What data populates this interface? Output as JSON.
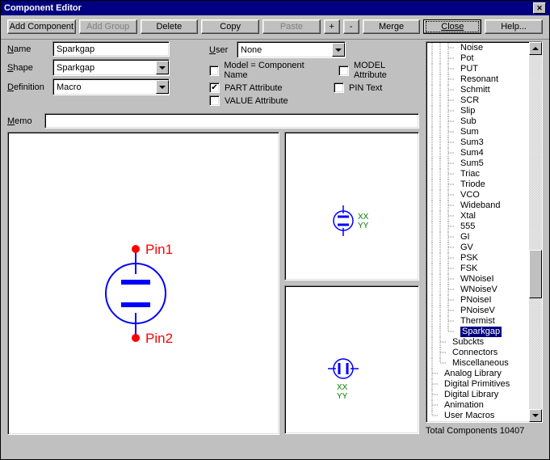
{
  "title": "Component Editor",
  "toolbar": {
    "add_component": "Add Component",
    "add_group": "Add Group",
    "delete": "Delete",
    "copy": "Copy",
    "paste": "Paste",
    "plus": "+",
    "minus": "-",
    "merge": "Merge",
    "close": "Close",
    "help": "Help..."
  },
  "form": {
    "name_label": "Name",
    "name_value": "Sparkgap",
    "shape_label": "Shape",
    "shape_value": "Sparkgap",
    "definition_label": "Definition",
    "definition_value": "Macro",
    "user_label": "User",
    "user_value": "None",
    "chk_model_comp": "Model = Component Name",
    "chk_part_attr": "PART Attribute",
    "chk_value_attr": "VALUE Attribute",
    "chk_model_attr": "MODEL Attribute",
    "chk_pin_text": "PIN Text",
    "memo_label": "Memo"
  },
  "preview": {
    "pin1": "Pin1",
    "pin2": "Pin2",
    "xx": "XX",
    "yy": "YY"
  },
  "tree": {
    "items": [
      {
        "level": 3,
        "label": "Noise"
      },
      {
        "level": 3,
        "label": "Pot"
      },
      {
        "level": 3,
        "label": "PUT"
      },
      {
        "level": 3,
        "label": "Resonant"
      },
      {
        "level": 3,
        "label": "Schmitt"
      },
      {
        "level": 3,
        "label": "SCR"
      },
      {
        "level": 3,
        "label": "Slip"
      },
      {
        "level": 3,
        "label": "Sub"
      },
      {
        "level": 3,
        "label": "Sum"
      },
      {
        "level": 3,
        "label": "Sum3"
      },
      {
        "level": 3,
        "label": "Sum4"
      },
      {
        "level": 3,
        "label": "Sum5"
      },
      {
        "level": 3,
        "label": "Triac"
      },
      {
        "level": 3,
        "label": "Triode"
      },
      {
        "level": 3,
        "label": "VCO"
      },
      {
        "level": 3,
        "label": "Wideband"
      },
      {
        "level": 3,
        "label": "Xtal"
      },
      {
        "level": 3,
        "label": "555"
      },
      {
        "level": 3,
        "label": "GI"
      },
      {
        "level": 3,
        "label": "GV"
      },
      {
        "level": 3,
        "label": "PSK"
      },
      {
        "level": 3,
        "label": "FSK"
      },
      {
        "level": 3,
        "label": "WNoiseI"
      },
      {
        "level": 3,
        "label": "WNoiseV"
      },
      {
        "level": 3,
        "label": "PNoiseI"
      },
      {
        "level": 3,
        "label": "PNoiseV"
      },
      {
        "level": 3,
        "label": "Thermist"
      },
      {
        "level": 3,
        "label": "Sparkgap",
        "selected": true,
        "last": true
      },
      {
        "level": 2,
        "label": "Subckts"
      },
      {
        "level": 2,
        "label": "Connectors"
      },
      {
        "level": 2,
        "label": "Miscellaneous",
        "last": true
      },
      {
        "level": 1,
        "label": "Analog Library"
      },
      {
        "level": 1,
        "label": "Digital Primitives"
      },
      {
        "level": 1,
        "label": "Digital Library"
      },
      {
        "level": 1,
        "label": "Animation"
      },
      {
        "level": 1,
        "label": "User Macros",
        "last": true
      }
    ]
  },
  "status": {
    "total": "Total Components 10407"
  }
}
